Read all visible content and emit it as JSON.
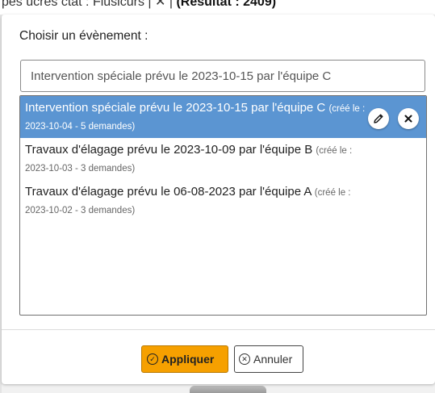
{
  "background": {
    "header_text_prefix": "pes ucres ctat : Flusicurs | ✕ |",
    "header_text_bold": "(Résultat : 2409)"
  },
  "dialog": {
    "title": "Choisir un évènement :",
    "search": {
      "value": "Intervention spéciale prévu le 2023-10-15 par l'équipe C",
      "placeholder": ""
    },
    "options": [
      {
        "label": "Intervention spéciale prévu le 2023-10-15 par l'équipe C",
        "created_prefix": "(créé le :",
        "details": "2023-10-04 - 5 demandes)",
        "selected": true
      },
      {
        "label": "Travaux d'élagage prévu le 2023-10-09 par l'équipe B",
        "created_prefix": "(créé le :",
        "details": "2023-10-03 - 3 demandes)",
        "selected": false
      },
      {
        "label": "Travaux d'élagage prévu le 06-08-2023 par l'équipe A",
        "created_prefix": "(créé le :",
        "details": "2023-10-02 - 3 demandes)",
        "selected": false
      }
    ],
    "row_actions": {
      "edit_icon": "pencil-icon",
      "delete_icon": "close-icon"
    },
    "buttons": {
      "apply_label": "Appliquer",
      "apply_icon": "check-circle-icon",
      "cancel_label": "Annuler",
      "cancel_icon": "x-circle-icon"
    }
  },
  "colors": {
    "selected_row": "#5b95d2",
    "apply_button": "#f6a000"
  }
}
